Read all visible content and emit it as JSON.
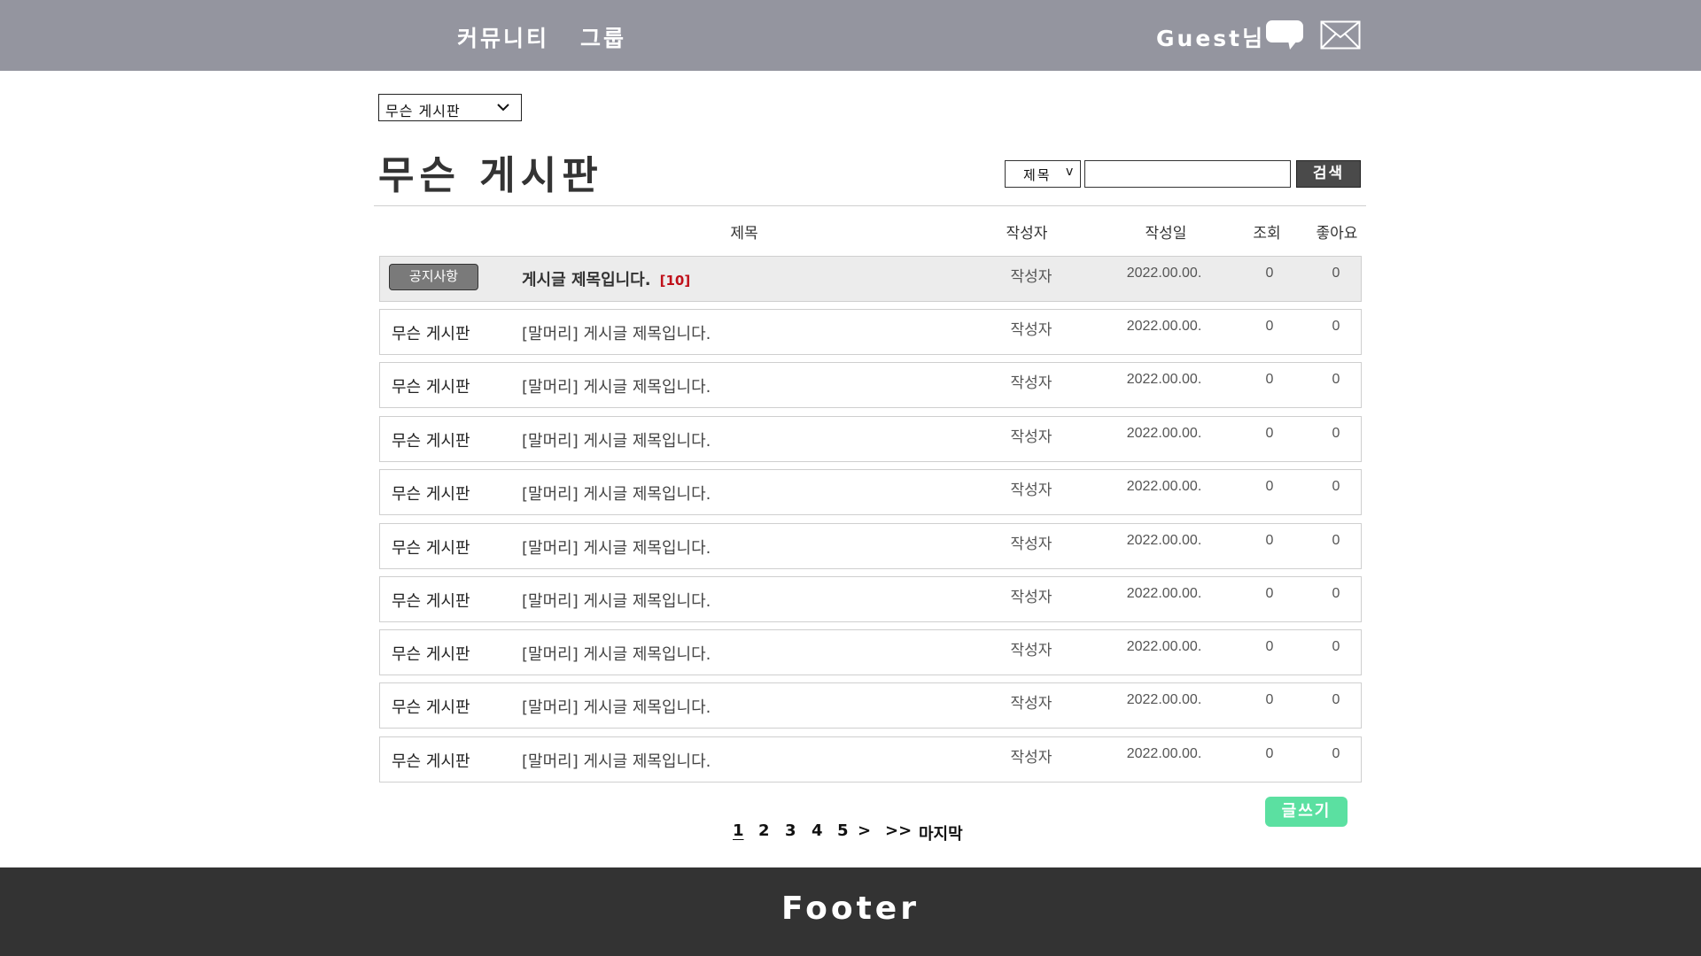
{
  "header": {
    "nav": [
      "커뮤니티",
      "그룹"
    ],
    "user_label": "Guest님",
    "icons": [
      "chat-bubble-icon",
      "mail-icon"
    ]
  },
  "board_select": {
    "selected": "무슨 게시판"
  },
  "page_title": "무슨 게시판",
  "search": {
    "field_selected": "제목",
    "field_caret": "v",
    "input_value": "",
    "button_label": "검색"
  },
  "table": {
    "columns": [
      "제목",
      "작성자",
      "작성일",
      "조회",
      "좋아요"
    ],
    "notice": {
      "badge": "공지사항",
      "title": "게시글 제목입니다.",
      "comments": "[10]",
      "author": "작성자",
      "date": "2022.00.00.",
      "views": "0",
      "likes": "0"
    },
    "rows": [
      {
        "category": "무슨 게시판",
        "title": "[말머리] 게시글 제목입니다.",
        "author": "작성자",
        "date": "2022.00.00.",
        "views": "0",
        "likes": "0"
      },
      {
        "category": "무슨 게시판",
        "title": "[말머리] 게시글 제목입니다.",
        "author": "작성자",
        "date": "2022.00.00.",
        "views": "0",
        "likes": "0"
      },
      {
        "category": "무슨 게시판",
        "title": "[말머리] 게시글 제목입니다.",
        "author": "작성자",
        "date": "2022.00.00.",
        "views": "0",
        "likes": "0"
      },
      {
        "category": "무슨 게시판",
        "title": "[말머리] 게시글 제목입니다.",
        "author": "작성자",
        "date": "2022.00.00.",
        "views": "0",
        "likes": "0"
      },
      {
        "category": "무슨 게시판",
        "title": "[말머리] 게시글 제목입니다.",
        "author": "작성자",
        "date": "2022.00.00.",
        "views": "0",
        "likes": "0"
      },
      {
        "category": "무슨 게시판",
        "title": "[말머리] 게시글 제목입니다.",
        "author": "작성자",
        "date": "2022.00.00.",
        "views": "0",
        "likes": "0"
      },
      {
        "category": "무슨 게시판",
        "title": "[말머리] 게시글 제목입니다.",
        "author": "작성자",
        "date": "2022.00.00.",
        "views": "0",
        "likes": "0"
      },
      {
        "category": "무슨 게시판",
        "title": "[말머리] 게시글 제목입니다.",
        "author": "작성자",
        "date": "2022.00.00.",
        "views": "0",
        "likes": "0"
      },
      {
        "category": "무슨 게시판",
        "title": "[말머리] 게시글 제목입니다.",
        "author": "작성자",
        "date": "2022.00.00.",
        "views": "0",
        "likes": "0"
      }
    ]
  },
  "write_button": "글쓰기",
  "pagination": {
    "pages": [
      "1",
      "2",
      "3",
      "4",
      "5"
    ],
    "current": "1",
    "next": ">",
    "next_block": ">>",
    "last": "마지막"
  },
  "footer": {
    "text": "Footer"
  },
  "colors": {
    "header_bg": "#94959f",
    "footer_bg": "#333333",
    "write_button": "#5be0a1",
    "comment_count": "#c0101a",
    "notice_row_bg": "#ececec"
  }
}
